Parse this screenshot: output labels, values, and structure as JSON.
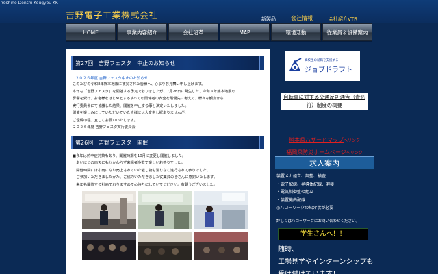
{
  "header": {
    "romaji": "Yoshino Denshi Kougyou KK",
    "company_name": "吉野電子工業株式会社",
    "top_links": [
      {
        "label": "新製品",
        "color": "#ffffff"
      },
      {
        "label": "会社情報",
        "color": "#ffd24a"
      },
      {
        "label": "会社紹介VTR",
        "color": "#ffd24a"
      }
    ]
  },
  "nav": {
    "items": [
      "HOME",
      "事業内容紹介",
      "会社沿革",
      "MAP",
      "環境活動",
      "従業員＆設備案内"
    ]
  },
  "main": {
    "section1": {
      "title": "第27回　吉野フェスタ　中止のお知らせ",
      "news_heading": "２０２６年度 吉野フェスタ中止のお知らせ",
      "lines": [
        "このたびの令和8年熊本地震に被災された皆様へ、心よりお見舞い申し上げます。",
        "本年も「吉野フェスタ」を開催する予定でおりましたが、7月28日に発生した、令和８年熊本地震の",
        "影響を受け、お客様をはじめとするすべての関係者の安全を最優先に考えて、様々な観点から",
        "実行委員会にて協議した結果、開催を中止する事と決定いたしました。",
        "開催を楽しみにしていただいていた皆様には大変申し訳ありませんが、",
        "ご理解の程、宜しくお願いいたします。",
        "２０２６年度 吉野フェスタ実行委員会"
      ]
    },
    "section2": {
      "title": "第26回　吉野フェスタ　開催",
      "lines": [
        "■今年は熱中症対策もあり、開催時期を10月に変更し開催しました。",
        "　あいにくの雨天にもかかわらず来場者多数で楽しいお祭りでした。",
        "　開催時間には小雨になり売上されていた催し物も滞りなく進行されて参りでした。",
        "　ご参加いただきましたかた、ご協力いただきました従業員の皆さんに感謝いたします。",
        "　来年も開催する計画でおりますので心待ちにしていてください。有難うございました。"
      ]
    }
  },
  "sidebar": {
    "job_banner": {
      "tagline": "高校生の就職を支援する",
      "brand": "ジョブドラフト"
    },
    "links": [
      {
        "label": "自転車に対する交通反則通告（青切符）制度の概要"
      },
      {
        "label": "熊本県ハザードマップ",
        "suffix": "へリンク"
      },
      {
        "label": "福岡県防災ホームページ",
        "suffix": "へリンク"
      }
    ],
    "recruit": {
      "title": "求人案内",
      "items": [
        "装置メカ組立、調整、検査",
        "・電子配線、半導体配線、溶接",
        "・電気制御盤の組立",
        "・装置機内配線",
        "◎ハローワークの紹介状が必要"
      ],
      "note": "詳しくはハローワークにお問い合わせください。"
    },
    "student": {
      "banner": "学生さんへ！！",
      "text_lines": [
        "随時、",
        "工場見学やインターンシップも",
        "受け付けています！"
      ]
    }
  },
  "colors": {
    "page_bg": "#0b2a55",
    "accent_gold": "#ffd24a",
    "link_red": "#e02020",
    "link_blue": "#1a5ec8"
  }
}
